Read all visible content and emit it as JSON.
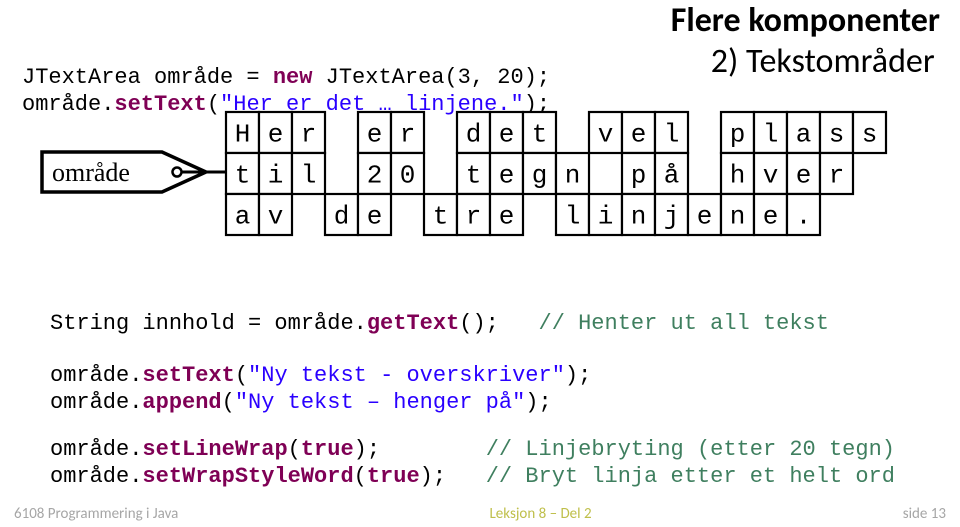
{
  "header": {
    "line1": "Flere komponenter",
    "line2": "2) Tekstområder"
  },
  "code1": {
    "t1": "JTextArea område = ",
    "kw1": "new",
    "t2": " JTextArea(3, 20);",
    "t3": "område.",
    "m1": "setText",
    "t4": "(",
    "s1": "\"Her er det … linjene.\"",
    "t5": ");"
  },
  "code2": {
    "t1": "String innhold = område.",
    "m1": "getText",
    "t2": "();   ",
    "c1": "// Henter ut all tekst"
  },
  "code3": {
    "t1": "område.",
    "m1": "setText",
    "t2": "(",
    "s1": "\"Ny tekst - overskriver\"",
    "t3": ");",
    "t4": "område.",
    "m2": "append",
    "t5": "(",
    "s2": "\"Ny tekst – henger på\"",
    "t6": ");"
  },
  "code4": {
    "t1": "område.",
    "m1": "setLineWrap",
    "t2": "(",
    "kw1": "true",
    "t3": ");        ",
    "c1": "// Linjebryting (etter 20 tegn)",
    "t4": "område.",
    "m2": "setWrapStyleWord",
    "t5": "(",
    "kw2": "true",
    "t6": ");   ",
    "c2": "// Bryt linja etter et helt ord"
  },
  "diagram": {
    "tag": "område",
    "row1": [
      [
        "H",
        "e",
        "r"
      ],
      [
        "e",
        "r"
      ],
      [
        "d",
        "e",
        "t"
      ],
      [
        "v",
        "e",
        "l"
      ],
      [
        "p",
        "l",
        "a",
        "s",
        "s"
      ]
    ],
    "row2": [
      [
        "t",
        "i",
        "l"
      ],
      [
        "2",
        "0"
      ],
      [
        "t",
        "e",
        "g",
        "n"
      ],
      [
        "p",
        "å"
      ],
      [
        "h",
        "v",
        "e",
        "r"
      ]
    ],
    "row3": [
      [
        "a",
        "v"
      ],
      [
        "d",
        "e"
      ],
      [
        "t",
        "r",
        "e"
      ],
      [
        "l",
        "i",
        "n",
        "j",
        "e",
        "n",
        "e",
        "."
      ]
    ]
  },
  "footer": {
    "left": "6108 Programmering i Java",
    "mid": "Leksjon 8 – Del 2",
    "right": "side 13"
  }
}
